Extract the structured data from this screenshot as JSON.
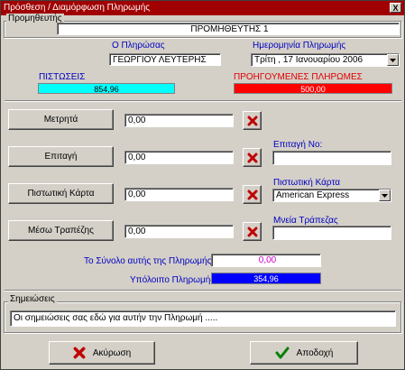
{
  "window": {
    "title": "Πρόσθεση / Διαμόρφωση Πληρωμής",
    "close_symbol": "X"
  },
  "supplier": {
    "group_title": "Προμηθευτής",
    "value": "ΠΡΟΜΗΘΕΥΤΗΣ 1"
  },
  "payer": {
    "label": "Ο Πληρώσας",
    "value": "ΓΕΩΡΓΙΟΥ ΛΕΥΤΕΡΗΣ"
  },
  "payment_date": {
    "label": "Ημερομηνία Πληρωμής",
    "value": "Τρίτη , 17 Ιανουαρίου 2006"
  },
  "credits": {
    "label": "ΠΙΣΤΩΣΕΙΣ",
    "value": "854,96",
    "color": "#00ffff"
  },
  "previous_payments": {
    "label": "ΠΡΟΗΓΟΥΜΕΝΕΣ ΠΛΗΡΩΜΕΣ",
    "value": "500,00",
    "color": "#ff0000"
  },
  "methods": [
    {
      "label": "Μετρητά",
      "amount": "0,00"
    },
    {
      "label": "Επιταγή",
      "amount": "0,00"
    },
    {
      "label": "Πιστωτική Κάρτα",
      "amount": "0,00"
    },
    {
      "label": "Μέσω Τραπέζης",
      "amount": "0,00"
    }
  ],
  "cheque_no": {
    "label": "Επιταγή Νο:",
    "value": ""
  },
  "credit_card": {
    "label": "Πιστωτική Κάρτα",
    "selected": "American Express"
  },
  "bank_note": {
    "label": "Μνεία Τράπεζας",
    "value": ""
  },
  "total": {
    "label": "Το Σύνολο αυτής της Πληρωμής",
    "value": "0,00",
    "color": "#cc00cc"
  },
  "remaining": {
    "label": "Υπόλοιπο Πληρωμής",
    "value": "354,96",
    "color": "#0000ff"
  },
  "notes": {
    "group_title": "Σημειώσεις",
    "value": "Οι σημειώσεις σας εδώ για αυτήν την Πληρωμή ....."
  },
  "buttons": {
    "cancel": "Ακύρωση",
    "accept": "Αποδοχή"
  },
  "icons": {
    "delete": "red-x-icon",
    "cancel": "red-x-icon",
    "accept": "green-check-icon",
    "calendar_dropdown": "chevron-down-icon",
    "card_dropdown": "chevron-down-icon"
  }
}
